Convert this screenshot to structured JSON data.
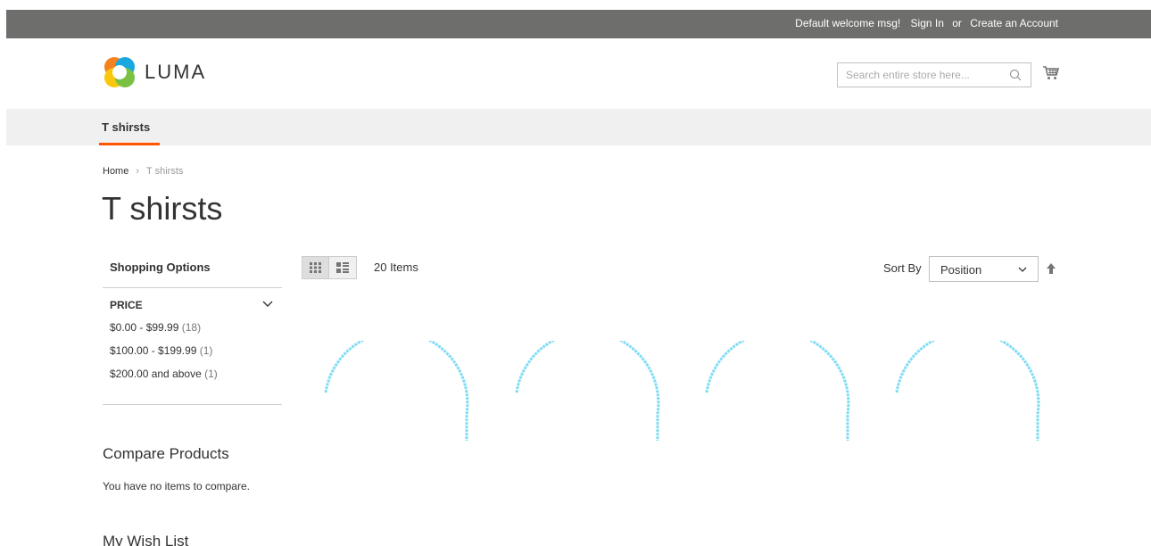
{
  "header": {
    "welcome": "Default welcome msg!",
    "sign_in": "Sign In",
    "or": "or",
    "create_account": "Create an Account"
  },
  "logo": {
    "text": "LUMA"
  },
  "search": {
    "placeholder": "Search entire store here..."
  },
  "nav": {
    "items": [
      {
        "label": "T shirsts",
        "active": true
      }
    ]
  },
  "breadcrumb": {
    "home": "Home",
    "separator": "›",
    "current": "T shirsts"
  },
  "page": {
    "title": "T shirsts"
  },
  "sidebar": {
    "shopping_options": "Shopping Options",
    "filter": {
      "title": "PRICE",
      "options": [
        {
          "label": "$0.00 - $99.99",
          "count": "(18)"
        },
        {
          "label": "$100.00 - $199.99",
          "count": "(1)"
        },
        {
          "label": "$200.00 and above",
          "count": "(1)"
        }
      ]
    },
    "compare": {
      "title": "Compare Products",
      "empty": "You have no items to compare."
    },
    "wishlist": {
      "title": "My Wish List"
    }
  },
  "toolbar": {
    "item_count": "20 Items",
    "sort_label": "Sort By",
    "sort_value": "Position",
    "view_modes": [
      "grid",
      "list"
    ],
    "active_view": "grid"
  },
  "products": {
    "loading_placeholders": 4
  },
  "colors": {
    "topbar": "#6e6e6c",
    "nav_bg": "#f0f0f0",
    "nav_accent": "#ff5501",
    "loader": "#7fdcf5"
  }
}
